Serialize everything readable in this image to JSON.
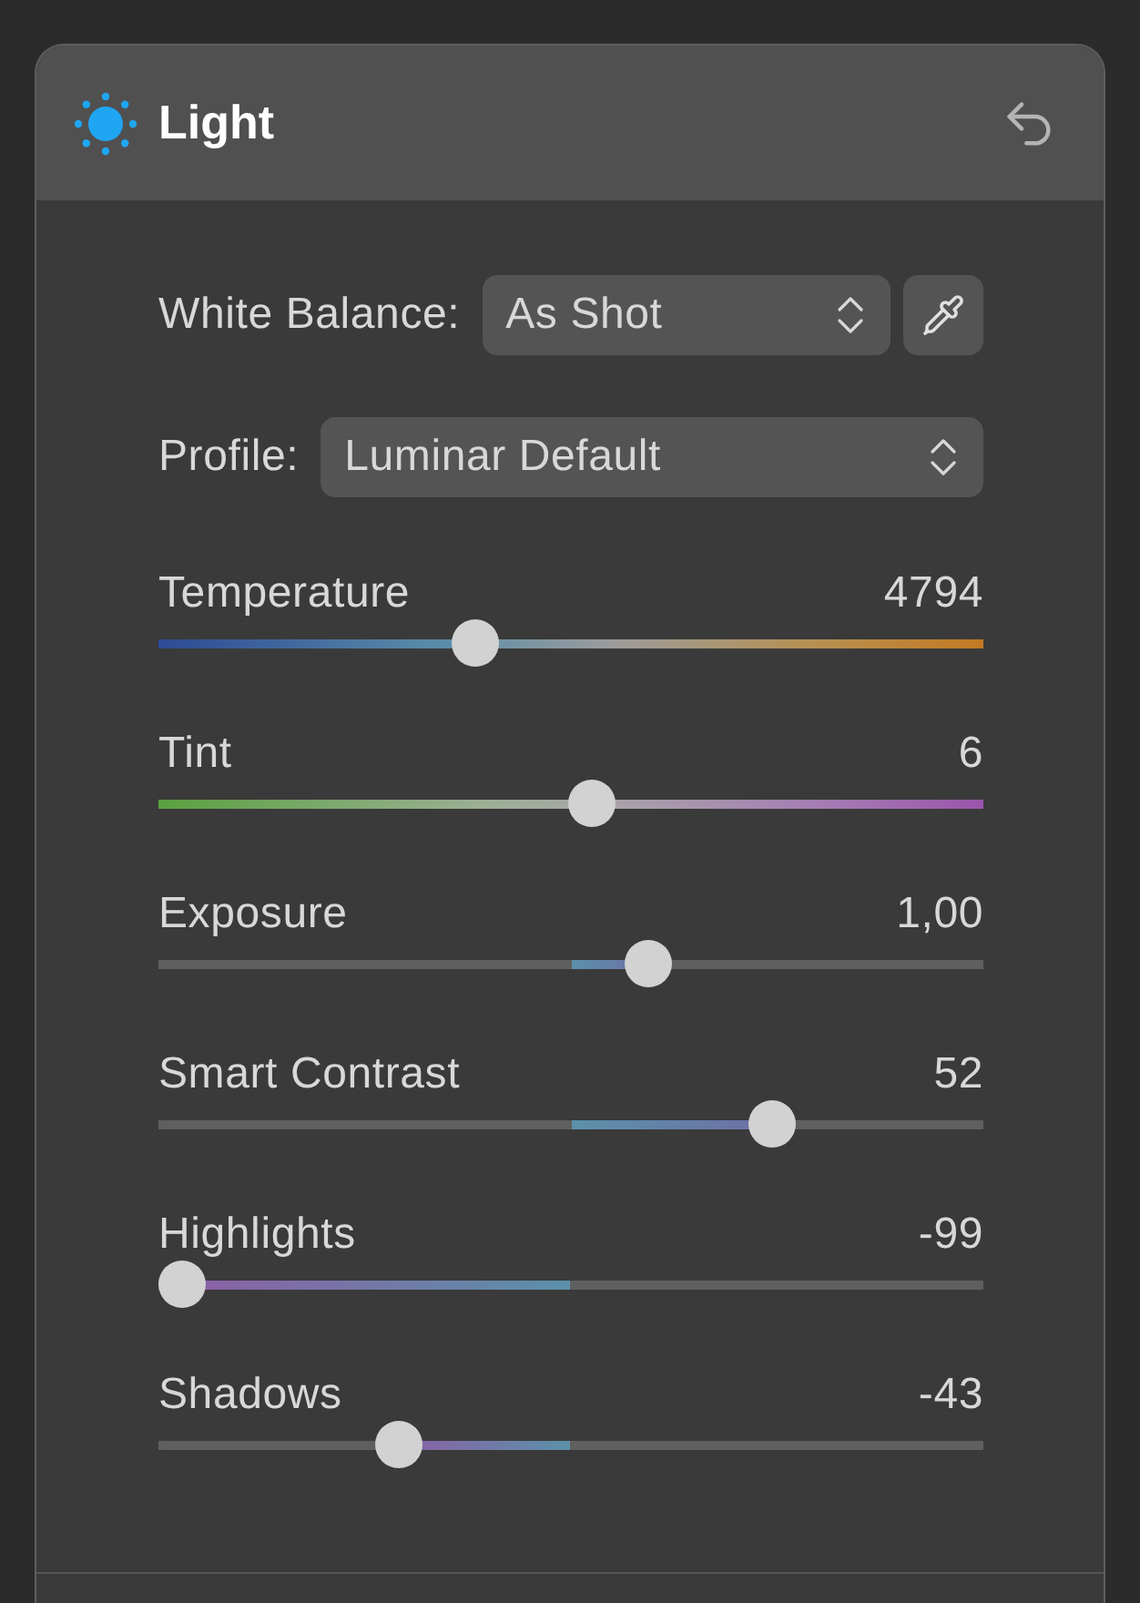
{
  "panel": {
    "title": "Light"
  },
  "white_balance": {
    "label": "White Balance:",
    "value": "As Shot"
  },
  "profile": {
    "label": "Profile:",
    "value": "Luminar Default"
  },
  "sliders": [
    {
      "kind": "temperature",
      "label": "Temperature",
      "reading": "4794",
      "level": 0.385
    },
    {
      "kind": "tint",
      "label": "Tint",
      "reading": "6",
      "level": 0.525
    },
    {
      "kind": "centered",
      "label": "Exposure",
      "reading": "1,00",
      "level": 0.593
    },
    {
      "kind": "centered",
      "label": "Smart Contrast",
      "reading": "52",
      "level": 0.745
    },
    {
      "kind": "centered",
      "label": "Highlights",
      "reading": "-99",
      "level": 0.029
    },
    {
      "kind": "centered",
      "label": "Shadows",
      "reading": "-43",
      "level": 0.292
    }
  ]
}
